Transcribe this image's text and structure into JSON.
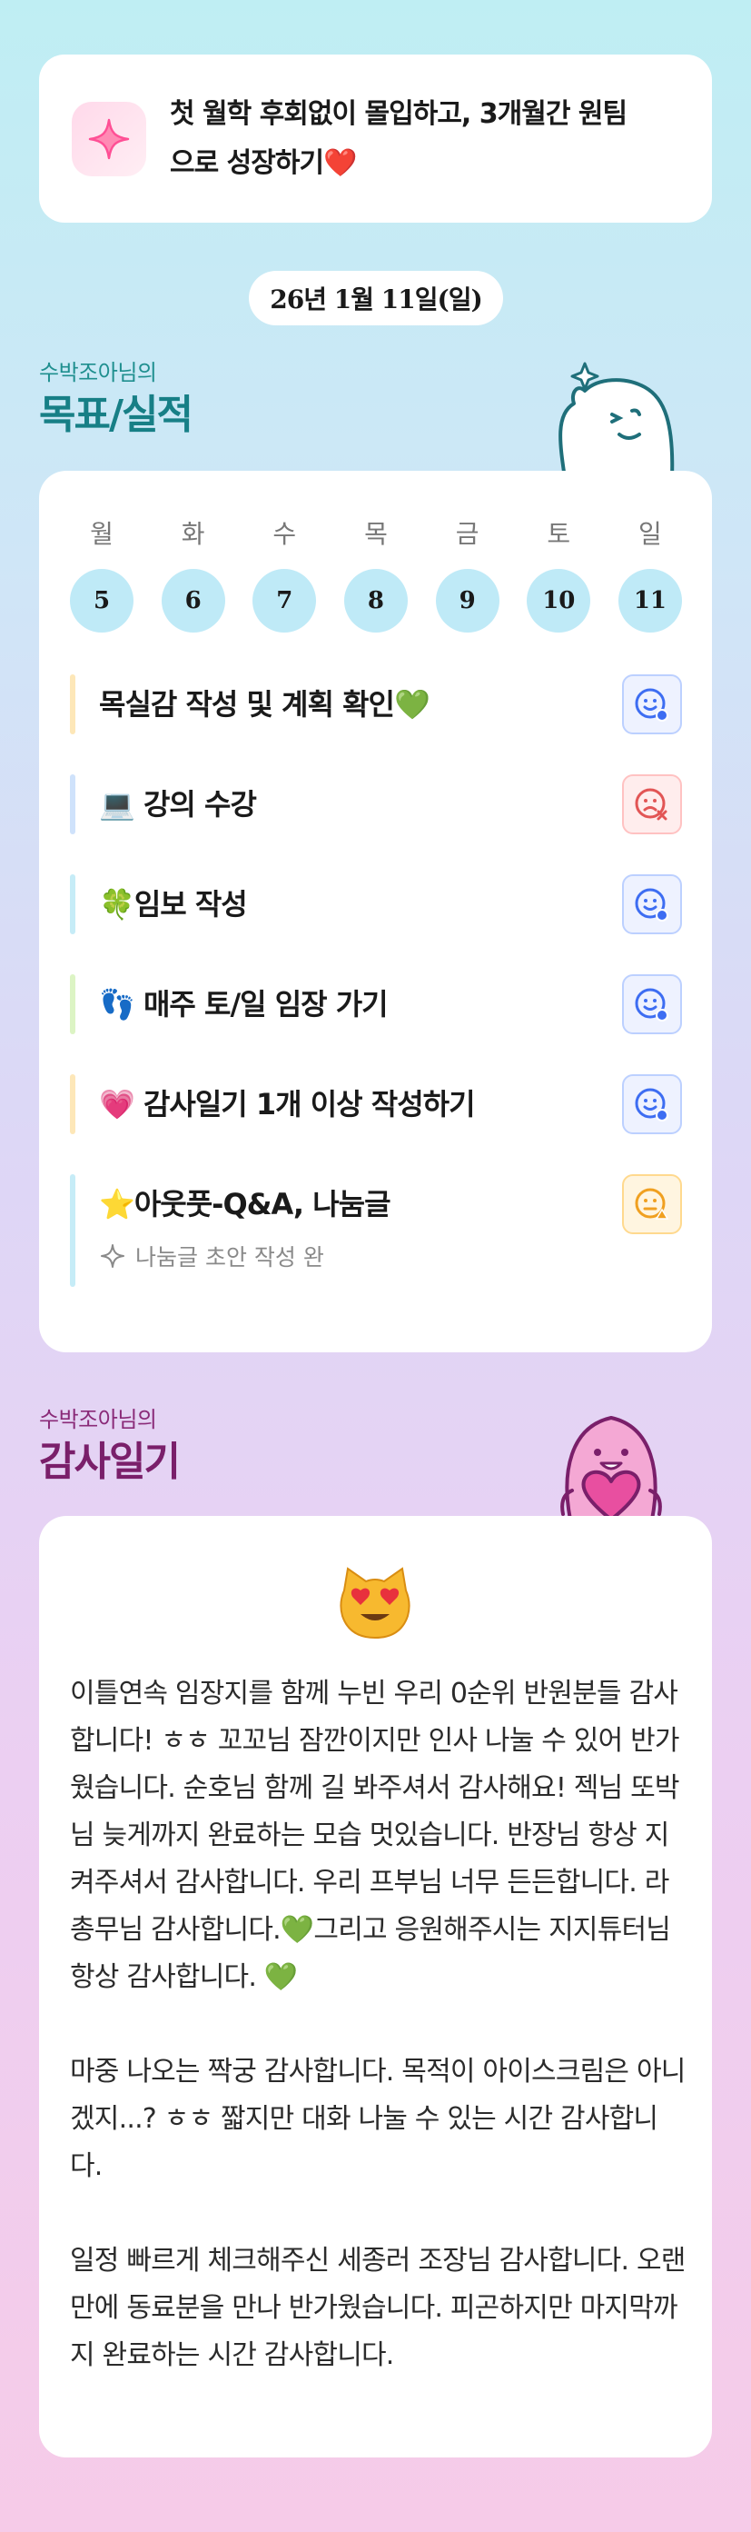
{
  "header": {
    "goal_line1": "첫 월학 후회없이 몰입하고, 3개월간 원팀",
    "goal_line2": "으로 성장하기❤️"
  },
  "date": "26년 1월 11일(일)",
  "goals_section": {
    "subtitle": "수박조아님의",
    "title": "목표/실적"
  },
  "week": {
    "labels": [
      "월",
      "화",
      "수",
      "목",
      "금",
      "토",
      "일"
    ],
    "days": [
      "5",
      "6",
      "7",
      "8",
      "9",
      "10",
      "11"
    ]
  },
  "tasks": [
    {
      "label": "목실감 작성 및 계획 확인💚",
      "bar_color": "#fde7b8",
      "status": "done"
    },
    {
      "label": "💻 강의 수강",
      "bar_color": "#cfe2fb",
      "status": "failed"
    },
    {
      "label": "🍀임보 작성",
      "bar_color": "#c6ecf7",
      "status": "done"
    },
    {
      "label": "👣 매주 토/일 임장 가기",
      "bar_color": "#dcf4c4",
      "status": "done"
    },
    {
      "label": "💗 감사일기 1개 이상 작성하기",
      "bar_color": "#fde7b8",
      "status": "done"
    },
    {
      "label": "⭐아웃풋-Q&A, 나눔글",
      "bar_color": "#c6ecf7",
      "status": "partial"
    }
  ],
  "task_note": "나눔글 초안 작성 완",
  "gratitude_section": {
    "subtitle": "수박조아님의",
    "title": "감사일기"
  },
  "gratitude": {
    "paragraphs": [
      "이틀연속 임장지를 함께 누빈 우리 0순위 반원분들 감사합니다! ㅎㅎ 꼬꼬님 잠깐이지만 인사 나눌 수 있어 반가웠습니다. 순호님 함께 길 봐주셔서 감사해요! 젝님 또박님 늦게까지 완료하는 모습 멋있습니다. 반장님 항상 지켜주셔서 감사합니다. 우리 프부님 너무 든든합니다. 라총무님 감사합니다.💚그리고 응원해주시는 지지튜터님 항상 감사합니다. 💚",
      "마중 나오는 짝궁 감사합니다. 목적이 아이스크림은 아니겠지...? ㅎㅎ 짧지만 대화 나눌 수 있는 시간 감사합니다.",
      "일정 빠르게 체크해주신 세종러 조장님 감사합니다. 오랜만에 동료분을 만나 반가웠습니다. 피곤하지만 마지막까지 완료하는 시간 감사합니다."
    ]
  },
  "colors": {
    "accent_teal": "#1f8f8f",
    "accent_purple": "#8a2a78",
    "status_done": "#3d6df2",
    "status_failed": "#e25555",
    "status_partial": "#f0a020"
  },
  "icons": {
    "goal": "sparkle-icon",
    "status_done": "smile-face-icon",
    "status_failed": "sad-face-icon",
    "status_partial": "worried-face-icon",
    "note": "sparkle-outline-icon",
    "gratitude": "heart-eyes-cat-emoji"
  }
}
